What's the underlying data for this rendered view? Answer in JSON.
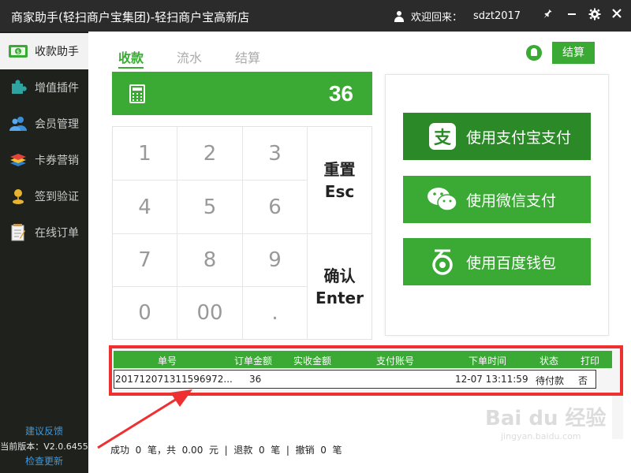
{
  "window": {
    "title": "商家助手(轻扫商户宝集团)-轻扫商户宝高新店",
    "welcome": "欢迎回来：",
    "username": "sdzt2017"
  },
  "sidebar": {
    "items": [
      {
        "label": "收款助手",
        "icon": "cash-icon"
      },
      {
        "label": "增值插件",
        "icon": "puzzle-icon"
      },
      {
        "label": "会员管理",
        "icon": "members-icon"
      },
      {
        "label": "卡券营销",
        "icon": "cards-icon"
      },
      {
        "label": "签到验证",
        "icon": "checkin-icon"
      },
      {
        "label": "在线订单",
        "icon": "notepad-icon"
      }
    ],
    "feedback": "建议反馈",
    "version": "当前版本：V2.0.6455",
    "check_update": "检查更新"
  },
  "tabs": [
    "收款",
    "流水",
    "结算"
  ],
  "settle_button": "结算",
  "display": {
    "amount": "36"
  },
  "keypad": {
    "digits": [
      "1",
      "2",
      "3",
      "4",
      "5",
      "6",
      "7",
      "8",
      "9",
      "0",
      "00",
      "."
    ],
    "reset_label": "重置",
    "reset_key": "Esc",
    "confirm_label": "确认",
    "confirm_key": "Enter"
  },
  "payment": {
    "alipay": "使用支付宝支付",
    "wechat": "使用微信支付",
    "baidu": "使用百度钱包"
  },
  "orders": {
    "headers": [
      "单号",
      "订单金额",
      "实收金额",
      "支付账号",
      "下单时间",
      "状态",
      "打印"
    ],
    "rows": [
      [
        "201712071311596972...",
        "36",
        "",
        "",
        "12-07 13:11:59",
        "待付款",
        "否"
      ]
    ]
  },
  "footer": {
    "success_label": "成功",
    "success_count": "0",
    "unit_bi": "笔",
    "total_label": "，共",
    "total_amount": "0.00",
    "unit_yuan": "元",
    "sep": "|",
    "refund_label": "退款",
    "refund_count": "0",
    "cancel_label": "撤销",
    "cancel_count": "0"
  },
  "watermark": {
    "main": "Bai du 经验",
    "sub": "jingyan.baidu.com"
  },
  "colors": {
    "brand_green": "#3aaa35",
    "dark_green": "#2b8a27",
    "sidebar_bg": "#1f211c",
    "titlebar_bg": "#2b2b2b",
    "highlight_red": "#ee3030"
  }
}
